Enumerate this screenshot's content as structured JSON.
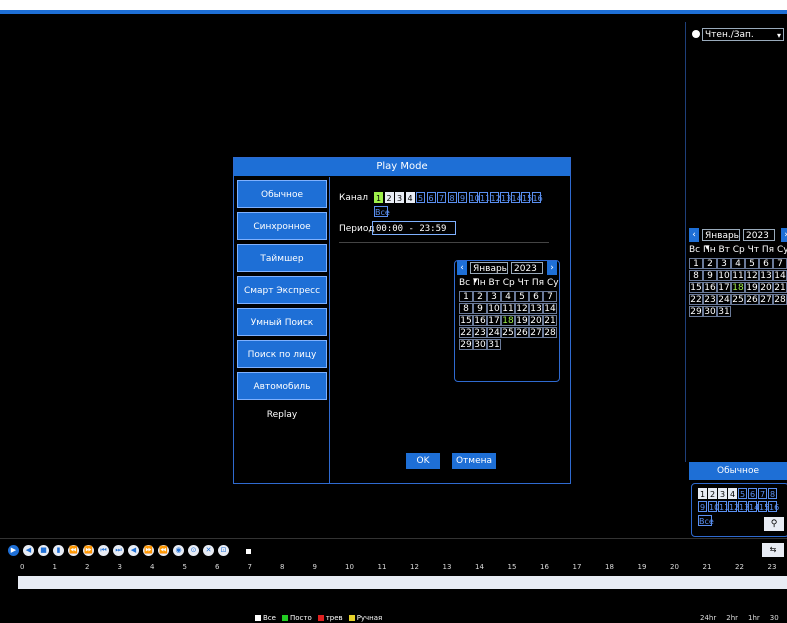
{
  "dialog": {
    "title": "Play Mode",
    "modes": [
      "Обычное",
      "Синхронное",
      "Таймшер",
      "Смарт Экспресс",
      "Умный Поиск",
      "Поиск по лицу",
      "Автомобиль Replay"
    ],
    "channel_label": "Канал",
    "channels": [
      "1",
      "2",
      "3",
      "4",
      "5",
      "6",
      "7",
      "8",
      "9",
      "10",
      "11",
      "12",
      "13",
      "14",
      "15",
      "16"
    ],
    "all_label": "Все",
    "period_label": "Период",
    "period_value": "00:00  -  23:59",
    "ok_label": "OK",
    "cancel_label": "Отмена"
  },
  "calendar": {
    "month": "Январь",
    "year": "2023",
    "dow": "Вс Пн Вт Ср Чт Пя Су",
    "days": [
      1,
      2,
      3,
      4,
      5,
      6,
      7,
      8,
      9,
      10,
      11,
      12,
      13,
      14,
      15,
      16,
      17,
      18,
      19,
      20,
      21,
      22,
      23,
      24,
      25,
      26,
      27,
      28,
      29,
      30,
      31
    ],
    "highlight_day": 18
  },
  "right_panel": {
    "select_value": "Чтен./Зап.",
    "calendar_dow": "Вс Пн Вт Ср Чт Пя Су",
    "mode_label": "Обычное",
    "channels": [
      "1",
      "2",
      "3",
      "4",
      "5",
      "6",
      "7",
      "8",
      "9",
      "10",
      "11",
      "12",
      "13",
      "14",
      "15",
      "16"
    ],
    "all_label": "Все"
  },
  "timeline": {
    "hours": [
      "0",
      "1",
      "2",
      "3",
      "4",
      "5",
      "6",
      "7",
      "8",
      "9",
      "10",
      "11",
      "12",
      "13",
      "14",
      "15",
      "16",
      "17",
      "18",
      "19",
      "20",
      "21",
      "22",
      "23"
    ]
  },
  "legend": {
    "items": [
      {
        "label": "Все",
        "color": "#ffffff"
      },
      {
        "label": "Посто",
        "color": "#22cc22"
      },
      {
        "label": "трев",
        "color": "#e02020"
      },
      {
        "label": "Ручная",
        "color": "#e6d22a"
      }
    ]
  },
  "zoom": {
    "labels": [
      "24hr",
      "2hr",
      "1hr",
      "30"
    ]
  },
  "colors": {
    "accent": "#1e6fd6",
    "highlight": "#9ef04a"
  }
}
